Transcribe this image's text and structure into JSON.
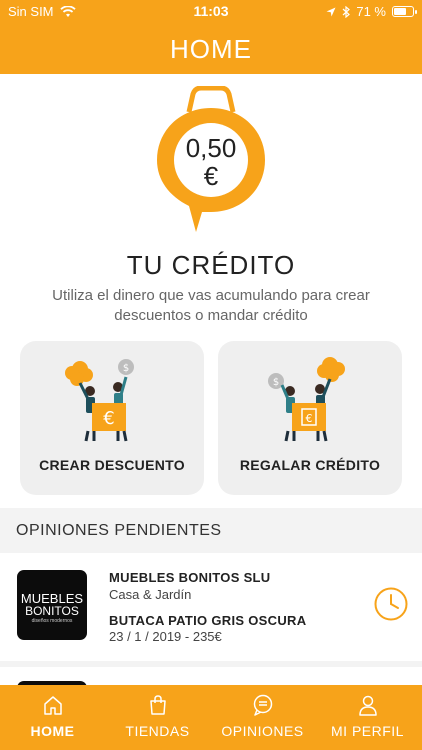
{
  "status_bar": {
    "carrier": "Sin SIM",
    "time": "11:03",
    "battery": "71 %",
    "battery_level": 0.71
  },
  "header": {
    "title": "HOME"
  },
  "credit": {
    "amount_value": "0,50",
    "amount_currency": "€",
    "title": "TU CRÉDITO",
    "description": "Utiliza el dinero que vas acumulando para crear descuentos o mandar crédito"
  },
  "actions": [
    {
      "label": "CREAR DESCUENTO",
      "icon": "create-discount-illustration"
    },
    {
      "label": "REGALAR CRÉDITO",
      "icon": "gift-credit-illustration"
    }
  ],
  "pending_reviews": {
    "section_title": "OPINIONES PENDIENTES",
    "items": [
      {
        "logo_line1": "MUEBLES",
        "logo_line2": "BONITOS",
        "logo_line3": "diseños modernos",
        "store": "MUEBLES BONITOS SLU",
        "category": "Casa & Jardín",
        "product": "BUTACA PATIO GRIS OSCURA",
        "meta": "23 / 1 / 2019 - 235€",
        "status_icon": "clock-icon"
      }
    ]
  },
  "tabbar": {
    "tabs": [
      {
        "label": "HOME",
        "icon": "home-icon",
        "active": true
      },
      {
        "label": "TIENDAS",
        "icon": "shopping-bag-icon",
        "active": false
      },
      {
        "label": "OPINIONES",
        "icon": "chat-bubble-icon",
        "active": false
      },
      {
        "label": "MI PERFIL",
        "icon": "user-icon",
        "active": false
      }
    ]
  },
  "colors": {
    "brand": "#f7a31a",
    "card_bg": "#efefef",
    "section_bg": "#f3f3f3"
  }
}
